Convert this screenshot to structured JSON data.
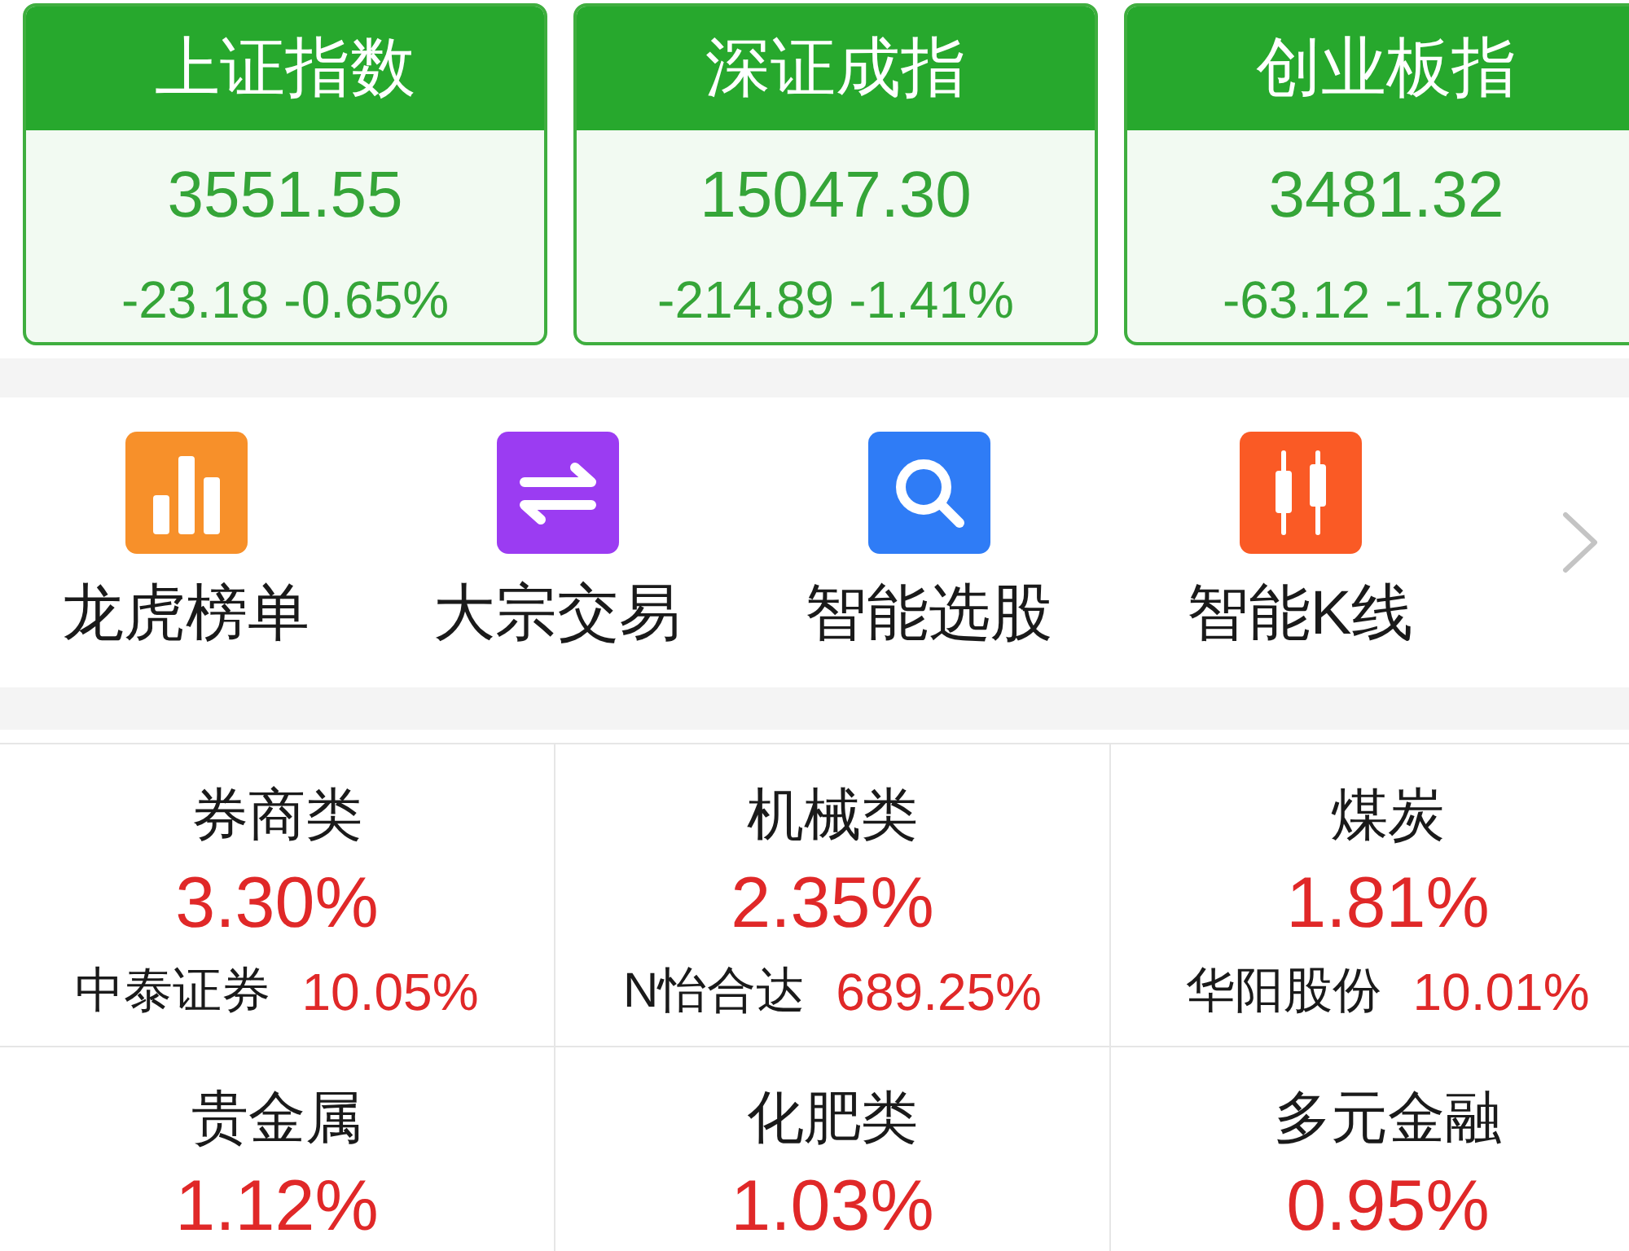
{
  "indices": [
    {
      "name": "上证指数",
      "value": "3551.55",
      "change": "-23.18",
      "change_pct": "-0.65%",
      "up": false
    },
    {
      "name": "深证成指",
      "value": "15047.30",
      "change": "-214.89",
      "change_pct": "-1.41%",
      "up": false
    },
    {
      "name": "创业板指",
      "value": "3481.32",
      "change": "-63.12",
      "change_pct": "-1.78%",
      "up": false
    }
  ],
  "shortcuts": [
    {
      "label": "龙虎榜单",
      "color": "#f7902a"
    },
    {
      "label": "大宗交易",
      "color": "#9b3cf2"
    },
    {
      "label": "智能选股",
      "color": "#2f7cf6"
    },
    {
      "label": "智能K线",
      "color": "#fa5a25"
    }
  ],
  "sectors": [
    {
      "name": "券商类",
      "change": "3.30%",
      "up": true,
      "leader": {
        "name": "中泰证券",
        "change": "10.05%",
        "up": true
      }
    },
    {
      "name": "机械类",
      "change": "2.35%",
      "up": true,
      "leader": {
        "name": "N怡合达",
        "change": "689.25%",
        "up": true
      }
    },
    {
      "name": "煤炭",
      "change": "1.81%",
      "up": true,
      "leader": {
        "name": "华阳股份",
        "change": "10.01%",
        "up": true
      }
    },
    {
      "name": "贵金属",
      "change": "1.12%",
      "up": true
    },
    {
      "name": "化肥类",
      "change": "1.03%",
      "up": true
    },
    {
      "name": "多元金融",
      "change": "0.95%",
      "up": true
    }
  ]
}
